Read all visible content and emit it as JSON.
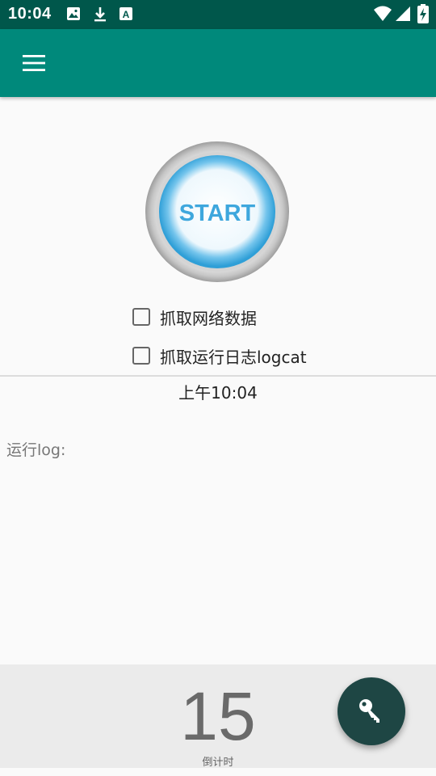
{
  "status_bar": {
    "time": "10:04",
    "icons": [
      "image-icon",
      "download-icon",
      "font-icon",
      "wifi-icon",
      "signal-icon",
      "battery-charging-icon"
    ]
  },
  "toolbar": {
    "menu_icon": "hamburger-menu-icon",
    "color": "#00897b"
  },
  "start_button": {
    "label": "START"
  },
  "options": [
    {
      "label": "抓取网络数据",
      "checked": false
    },
    {
      "label": "抓取运行日志logcat",
      "checked": false
    }
  ],
  "current_time": "上午10:04",
  "log": {
    "label": "运行log:"
  },
  "countdown": {
    "value": "15",
    "label": "倒计时"
  },
  "fab": {
    "icon": "key-icon",
    "color": "#1e4644"
  }
}
